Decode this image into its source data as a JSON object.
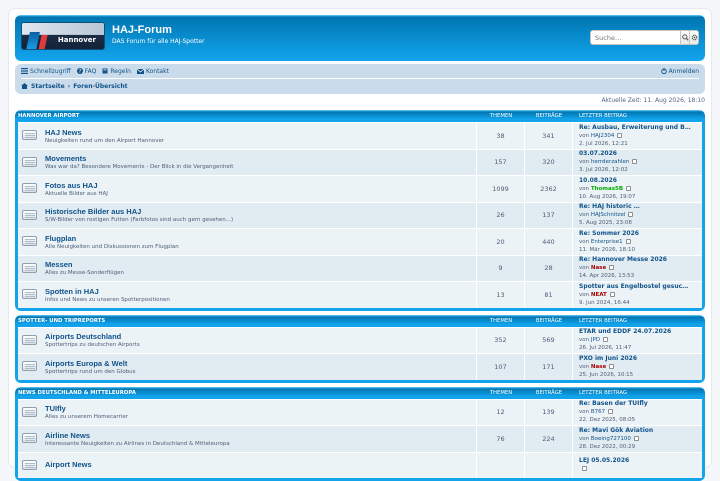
{
  "header": {
    "logo_text": "Hannover",
    "site_title": "HAJ-Forum",
    "site_description": "DAS Forum für alle HAJ-Spotter",
    "search_placeholder": "Suche…",
    "search_icon": "magnifier-icon",
    "advanced_search_icon": "gear-icon"
  },
  "nav": {
    "quick_access": "Schnellzugriff",
    "faq": "FAQ",
    "rules": "Regeln",
    "contact": "Kontakt",
    "login": "Anmelden",
    "breadcrumb_home": "Startseite",
    "breadcrumb_index": "Foren-Übersicht"
  },
  "current_time": "Aktuelle Zeit: 11. Aug 2026, 18:10",
  "columns": {
    "topics": "THEMEN",
    "posts": "BEITRÄGE",
    "last_post": "LETZTER BEITRAG"
  },
  "categories": [
    {
      "name": "HANNOVER AIRPORT",
      "forums": [
        {
          "title": "HAJ News",
          "desc": "Neuigkeiten rund um den Airport Hannover",
          "topics": "38",
          "posts": "341",
          "last_title": "Re: Ausbau, Erweiterung und B…",
          "by": "von",
          "user": "HAJ2304",
          "user_style": "normal",
          "date": "2. Jul 2026, 12:21"
        },
        {
          "title": "Movements",
          "desc": "Was war da? Besondere Movements - Der Blick in die Vergangenheit",
          "topics": "157",
          "posts": "320",
          "last_title": "03.07.2026",
          "by": "von",
          "user": "herrderzahlen",
          "user_style": "normal",
          "date": "3. Jul 2026, 12:02"
        },
        {
          "title": "Fotos aus HAJ",
          "desc": "Aktuelle Bilder aus HAJ",
          "topics": "1099",
          "posts": "2362",
          "last_title": "10.08.2026",
          "by": "von",
          "user": "Thomas5B",
          "user_style": "green",
          "date": "10. Aug 2026, 19:07"
        },
        {
          "title": "Historische Bilder aus HAJ",
          "desc": "S/W-Bilder von rostigen Futten (Farbfotos sind auch gern gesehen...)",
          "topics": "26",
          "posts": "137",
          "last_title": "Re: HAJ historic …",
          "by": "von",
          "user": "HAJSchnitzel",
          "user_style": "normal",
          "date": "5. Aug 2025, 23:08"
        },
        {
          "title": "Flugplan",
          "desc": "Alle Neuigkeiten und Diskussionen zum Flugplan",
          "topics": "20",
          "posts": "440",
          "last_title": "Re: Sommer 2026",
          "by": "von",
          "user": "Enterprise1",
          "user_style": "normal",
          "date": "11. Mär 2026, 18:10"
        },
        {
          "title": "Messen",
          "desc": "Alles zu Messe-Sonderflügen",
          "topics": "9",
          "posts": "28",
          "last_title": "Re: Hannover Messe 2026",
          "by": "von",
          "user": "Nase",
          "user_style": "red",
          "date": "14. Apr 2026, 13:53"
        },
        {
          "title": "Spotten in HAJ",
          "desc": "Infos und News zu unseren Spotterpositionen",
          "topics": "13",
          "posts": "81",
          "last_title": "Spotter aus Engelbostel gesuc…",
          "by": "von",
          "user": "NEAT",
          "user_style": "red",
          "date": "9. Jun 2024, 16:44"
        }
      ]
    },
    {
      "name": "SPOTTER- UND TRIPREPORTS",
      "forums": [
        {
          "title": "Airports Deutschland",
          "desc": "Spottertrips zu deutschen Airports",
          "topics": "352",
          "posts": "569",
          "last_title": "ETAR und EDDF 24.07.2026",
          "by": "von",
          "user": "JPD",
          "user_style": "normal",
          "date": "26. Jul 2026, 11:47"
        },
        {
          "title": "Airports Europa & Welt",
          "desc": "Spottertrips rund um den Globus",
          "topics": "107",
          "posts": "171",
          "last_title": "PXO im Juni 2026",
          "by": "von",
          "user": "Nase",
          "user_style": "red",
          "date": "25. Jun 2026, 10:15"
        }
      ]
    },
    {
      "name": "NEWS DEUTSCHLAND & MITTELEUROPA",
      "forums": [
        {
          "title": "TUIfly",
          "desc": "Alles zu unserem Homecarrier",
          "topics": "12",
          "posts": "139",
          "last_title": "Re: Basen der TUIfly",
          "by": "von",
          "user": "B767",
          "user_style": "normal",
          "date": "22. Dez 2025, 08:05"
        },
        {
          "title": "Airline News",
          "desc": "Interessante Neuigkeiten zu Airlines in Deutschland & Mitteleuropa",
          "topics": "76",
          "posts": "224",
          "last_title": "Re: Mavi Gök Aviation",
          "by": "von",
          "user": "Boeing727100",
          "user_style": "normal",
          "date": "28. Dez 2022, 00:29"
        },
        {
          "title": "Airport News",
          "desc": "",
          "topics": "",
          "posts": "",
          "last_title": "LEJ 05.05.2026",
          "by": "",
          "user": "",
          "user_style": "normal",
          "date": ""
        }
      ]
    }
  ],
  "colors": {
    "header_blue": "#12a3eb",
    "nav_bg": "#cadceb",
    "link": "#105289",
    "row_a": "#ecf3f7",
    "row_b": "#e1ebf2",
    "moderator_red": "#aa0000",
    "member_green": "#00aa00"
  }
}
